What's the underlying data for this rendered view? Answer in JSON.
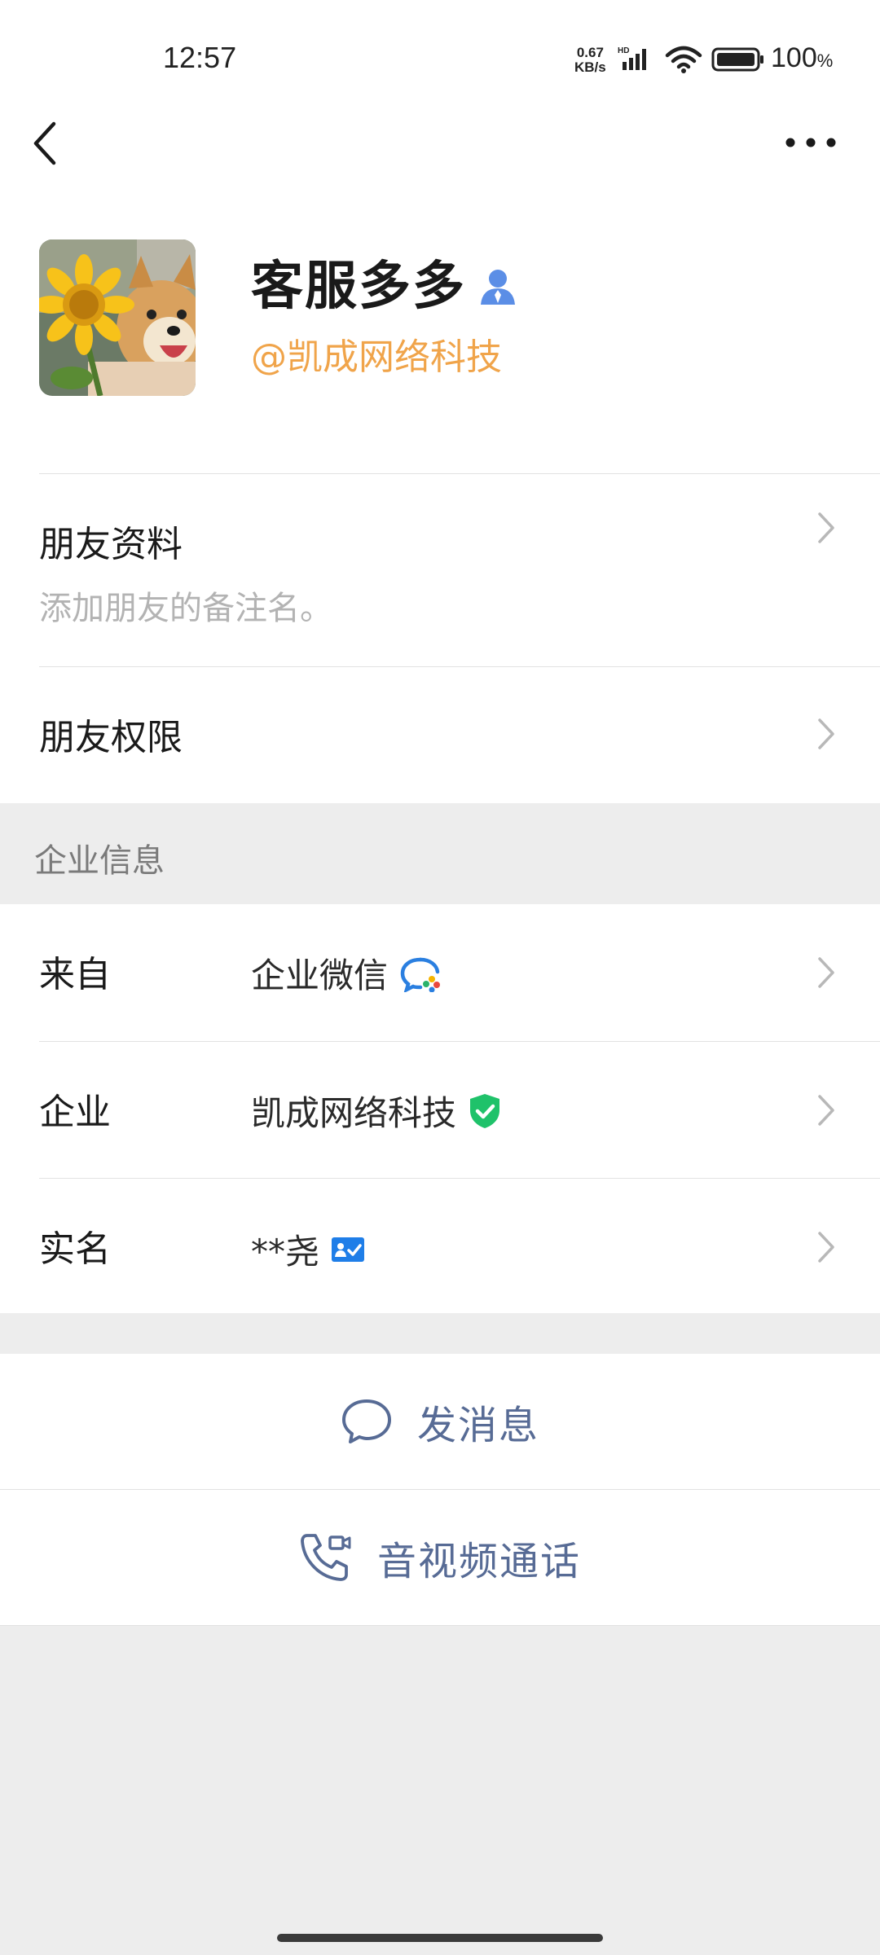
{
  "status_bar": {
    "time": "12:57",
    "net_speed_value": "0.67",
    "net_speed_unit": "KB/s",
    "network_type": "HD",
    "battery_value": "100",
    "battery_unit": "%"
  },
  "nav": {
    "back_icon": "chevron-left-icon",
    "more_icon": "more-dots-icon"
  },
  "profile": {
    "name": "客服多多",
    "name_badge_icon": "person-icon",
    "company_handle": "@凯成网络科技",
    "avatar_description": "shiba-dog-with-sunflower"
  },
  "friend_info": {
    "title": "朋友资料",
    "subtitle": "添加朋友的备注名。"
  },
  "friend_permissions": {
    "title": "朋友权限"
  },
  "enterprise_section": {
    "header": "企业信息",
    "rows": [
      {
        "label": "来自",
        "value": "企业微信",
        "icon": "wecom-icon"
      },
      {
        "label": "企业",
        "value": "凯成网络科技",
        "icon": "verified-shield-icon"
      },
      {
        "label": "实名",
        "value": "**尧",
        "icon": "id-card-icon"
      }
    ]
  },
  "actions": {
    "send_message": "发消息",
    "av_call": "音视频通话"
  },
  "colors": {
    "accent_link": "#576b95",
    "company_orange": "#f0a44a",
    "verified_green": "#1fc26a",
    "background_gray": "#ededed"
  }
}
